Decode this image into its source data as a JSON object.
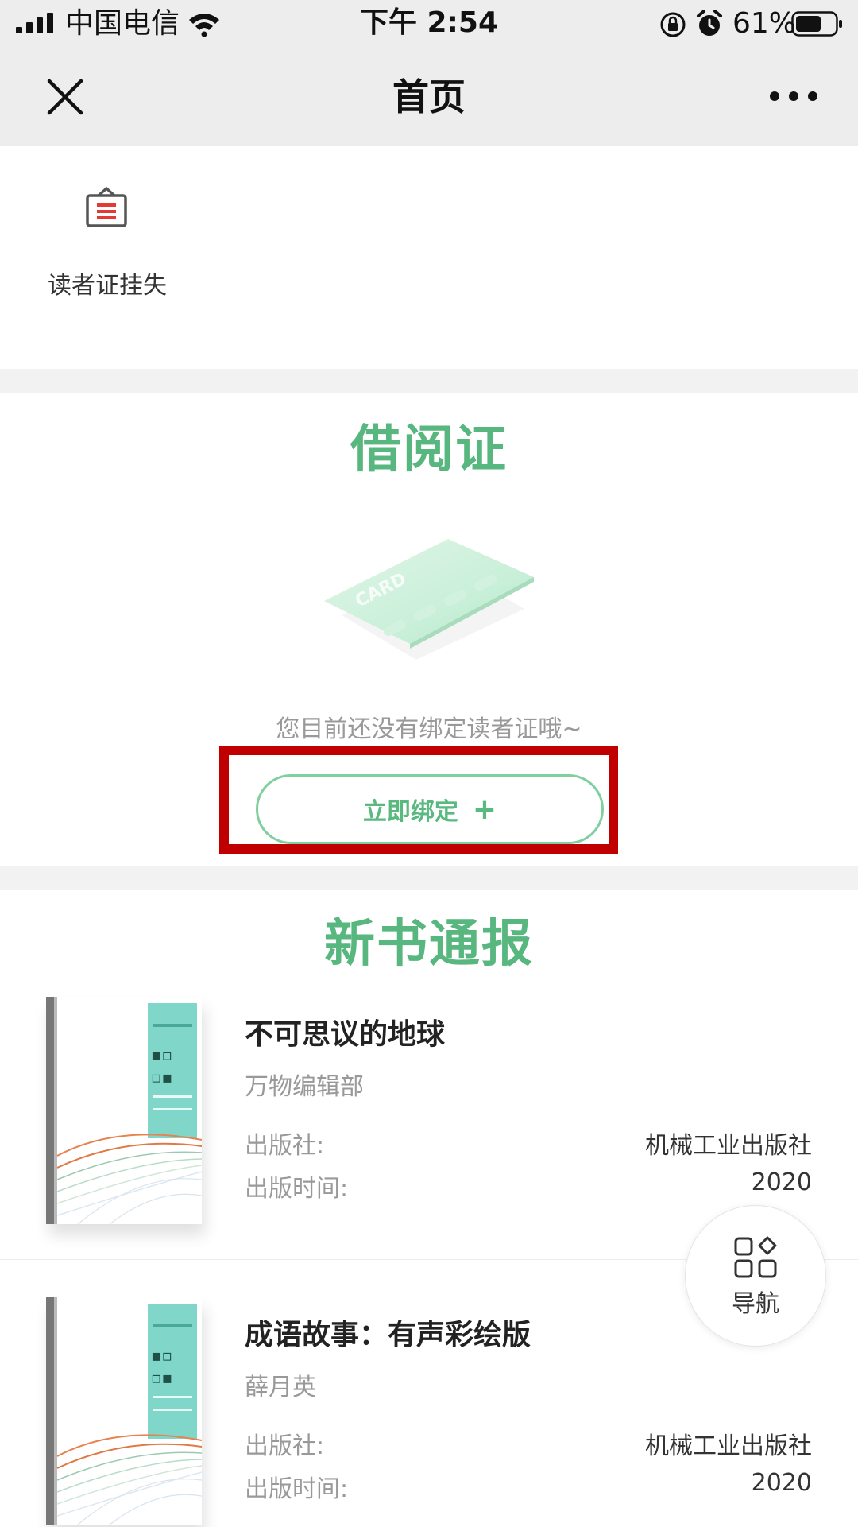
{
  "status_bar": {
    "carrier": "中国电信",
    "time": "下午 2:54",
    "battery": "61%"
  },
  "nav": {
    "title": "首页"
  },
  "quick_actions": [
    {
      "label": "读者证挂失",
      "icon": "id-card-lost-icon",
      "color": "#e53935"
    }
  ],
  "borrow_card": {
    "title": "借阅证",
    "card_text": "CARD",
    "empty_message": "您目前还没有绑定读者证哦~",
    "bind_button": "立即绑定",
    "bind_icon": "plus-icon"
  },
  "new_books": {
    "title": "新书通报",
    "items": [
      {
        "title": "不可思议的地球",
        "author": "万物编辑部",
        "publisher_label": "出版社:",
        "publisher": "机械工业出版社",
        "year_label": "出版时间:",
        "year": "2020"
      },
      {
        "title": "成语故事：有声彩绘版",
        "author": "薛月英",
        "publisher_label": "出版社:",
        "publisher": "机械工业出版社",
        "year_label": "出版时间:",
        "year": "2020"
      }
    ]
  },
  "float_nav": {
    "label": "导航",
    "icon": "grid-icon"
  },
  "colors": {
    "accent_green": "#58b77f",
    "highlight_red": "#c00000",
    "header_bg": "#ededed"
  }
}
